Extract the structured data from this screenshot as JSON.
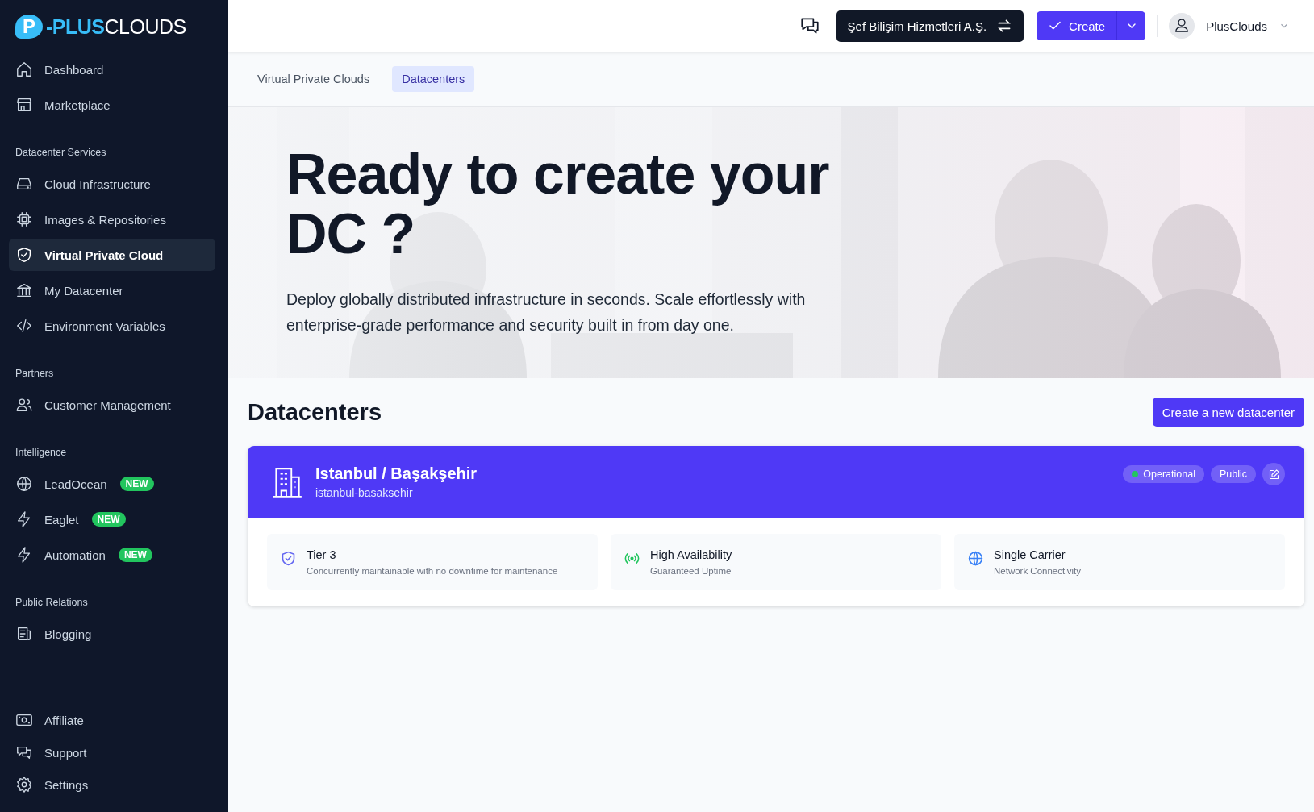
{
  "brand": {
    "mark": "P",
    "name_bold": "-PLUS",
    "name_light": "CLOUDS"
  },
  "sidebar": {
    "sections": [
      {
        "items": [
          {
            "label": "Dashboard",
            "selected": false
          },
          {
            "label": "Marketplace",
            "selected": false
          }
        ]
      },
      {
        "header": "Datacenter Services",
        "items": [
          {
            "label": "Cloud Infrastructure",
            "selected": false
          },
          {
            "label": "Images & Repositories",
            "selected": false
          },
          {
            "label": "Virtual Private Cloud",
            "selected": true
          },
          {
            "label": "My Datacenter",
            "selected": false
          },
          {
            "label": "Environment Variables",
            "selected": false
          }
        ]
      },
      {
        "header": "Partners",
        "items": [
          {
            "label": "Customer Management",
            "selected": false
          }
        ]
      },
      {
        "header": "Intelligence",
        "items": [
          {
            "label": "LeadOcean",
            "selected": false,
            "badge": "NEW"
          },
          {
            "label": "Eaglet",
            "selected": false,
            "badge": "NEW"
          },
          {
            "label": "Automation",
            "selected": false,
            "badge": "NEW"
          }
        ]
      },
      {
        "header": "Public Relations",
        "items": [
          {
            "label": "Blogging",
            "selected": false
          }
        ]
      }
    ],
    "footer_items": [
      {
        "label": "Affiliate",
        "selected": false
      },
      {
        "label": "Support",
        "selected": false
      },
      {
        "label": "Settings",
        "selected": false
      }
    ]
  },
  "header": {
    "organization": "Şef Bilişim Hizmetleri A.Ş.",
    "create_button": "Create",
    "user": "PlusClouds"
  },
  "tabs": [
    {
      "label": "Virtual Private Clouds",
      "selected": false
    },
    {
      "label": "Datacenters",
      "selected": true
    }
  ],
  "hero": {
    "title": "Ready to create your DC ?",
    "subtitle": "Deploy globally distributed infrastructure in seconds. Scale effortlessly with enterprise-grade performance and security built in from day one."
  },
  "datacenters": {
    "title": "Datacenters",
    "new_button": "Create a new datacenter",
    "items": [
      {
        "name": "Istanbul / Başakşehir",
        "slug": "istanbul-basaksehir",
        "status": {
          "label": "Operational",
          "color": "#22c55e"
        },
        "visibility": "Public",
        "features": [
          {
            "title": "Tier 3",
            "description": "Concurrently maintainable with no downtime for maintenance"
          },
          {
            "title": "High Availability",
            "description": "Guaranteed Uptime"
          },
          {
            "title": "Single Carrier",
            "description": "Network Connectivity"
          }
        ]
      }
    ]
  }
}
